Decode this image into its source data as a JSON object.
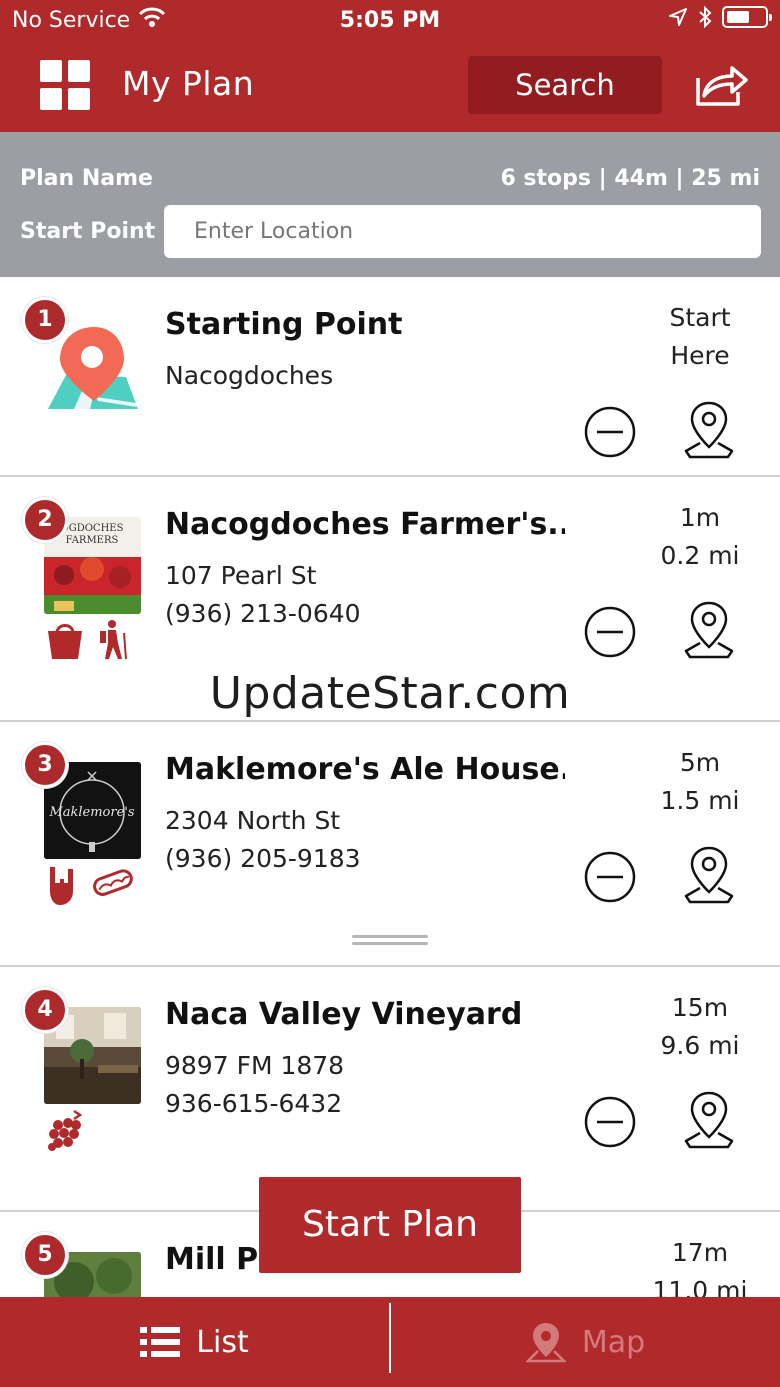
{
  "status_bar": {
    "carrier": "No Service",
    "time": "5:05 PM"
  },
  "header": {
    "title": "My Plan",
    "search_label": "Search"
  },
  "plan": {
    "name_label": "Plan Name",
    "stats": "6 stops | 44m | 25 mi",
    "start_point_label": "Start Point",
    "location_placeholder": "Enter Location"
  },
  "stops": [
    {
      "number": "1",
      "name": "Starting Point",
      "line1": "Nacogdoches",
      "line2": "",
      "time": "Start",
      "distance": "Here"
    },
    {
      "number": "2",
      "name": "Nacogdoches Farmer's...",
      "line1": "107 Pearl St",
      "line2": "(936) 213-0640",
      "time": "1m",
      "distance": "0.2 mi",
      "thumb_text": "OGDOCHES FARMERS",
      "categories": [
        "shopping-bag-icon",
        "hiker-icon"
      ]
    },
    {
      "number": "3",
      "name": "Maklemore's Ale House...",
      "line1": "2304 North St",
      "line2": "(936) 205-9183",
      "time": "5m",
      "distance": "1.5 mi",
      "thumb_text": "Maklemore's",
      "categories": [
        "rock-hand-icon",
        "hotdog-icon"
      ]
    },
    {
      "number": "4",
      "name": "Naca Valley Vineyard",
      "line1": "9897 FM 1878",
      "line2": "936-615-6432",
      "time": "15m",
      "distance": "9.6 mi",
      "categories": [
        "grapes-icon"
      ]
    },
    {
      "number": "5",
      "name": "Mill Po",
      "line1": "",
      "line2": "",
      "time": "17m",
      "distance": "11.0 mi"
    }
  ],
  "watermark": "UpdateStar.com",
  "start_plan_label": "Start Plan",
  "tabs": {
    "list_label": "List",
    "map_label": "Map"
  },
  "colors": {
    "brand_red": "#b02a2b",
    "header_gray": "#9b9ea2"
  }
}
